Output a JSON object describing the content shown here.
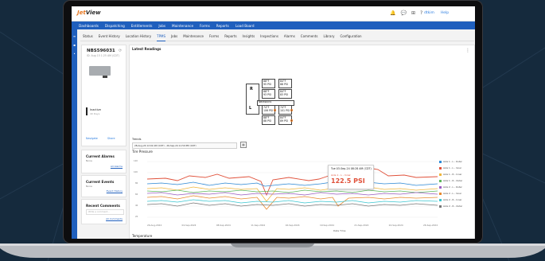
{
  "brand": {
    "logo_prefix": "Jet",
    "logo_suffix": "View"
  },
  "header": {
    "icons": [
      "bell-icon",
      "chat-icon",
      "grid-icon",
      "help-icon"
    ],
    "user": "dtkim",
    "help": "Help"
  },
  "nav": {
    "items": [
      "Dashboards",
      "Dispatching",
      "Entitlements",
      "Jobs",
      "Maintenance",
      "Forms",
      "Reports",
      "Load Board"
    ]
  },
  "tabs": {
    "items": [
      "Status",
      "Event History",
      "Location History",
      "TPMS",
      "Jobs",
      "Maintenance",
      "Forms",
      "Reports",
      "Insights",
      "Inspections",
      "Alarms",
      "Comments",
      "Library",
      "Configuration"
    ],
    "active": "TPMS"
  },
  "asset": {
    "name": "NBS596031",
    "subtitle": "ID: Aug 15 1:25 AM (CDT)",
    "status": "Inactive",
    "status_sub": "40 Days",
    "navigate": "Navigate",
    "share": "Share"
  },
  "alarms": {
    "title": "Current Alarms",
    "value": "None",
    "link": "All Alarms"
  },
  "events": {
    "title": "Current Events",
    "value": "None",
    "link": "Event History"
  },
  "comments": {
    "title": "Recent Comments",
    "placeholder": "Write a comment...",
    "link": "All Comments"
  },
  "readings": {
    "title": "Latest Readings",
    "right_label": "R",
    "left_label": "L",
    "axle_label": "NBS596031",
    "boxes": [
      {
        "t": "88°F",
        "p": "95 PSI"
      },
      {
        "t": "84°F",
        "p": "88 PSI"
      },
      {
        "t": "88°F",
        "p": "93 PSI"
      },
      {
        "t": "84°F",
        "p": "83 PSI"
      },
      {
        "t": "74°F",
        "p": "106 PSI"
      },
      {
        "t": "74°F",
        "p": "101 PSI"
      },
      {
        "t": "88°F",
        "p": "88 PSI"
      },
      {
        "t": "84°F",
        "p": "89 PSI"
      }
    ]
  },
  "trends": {
    "label": "Trends",
    "date_range": "28-Aug-24 12:02 AM (CDT) - 26-Sep-24 11:59 PM (CDT)",
    "chart_title": "Tire Pressure",
    "temp_title": "Temperature",
    "x_title": "Date Time",
    "y_title": "Pressure (psi) / Temp (°F)"
  },
  "chart_data": {
    "type": "line",
    "x": [
      "29-Aug-2024",
      "04-Sep-2024",
      "08-Sep-2024",
      "11-Sep-2024",
      "16-Sep-2024",
      "19-Sep-2024",
      "21-Sep-2024",
      "24-Sep-2024",
      "26-Sep-2024",
      "27-Sep-2024"
    ],
    "y_ticks": [
      "120",
      "100",
      "80",
      "60",
      "40",
      "20"
    ],
    "series": [
      {
        "name": "Axle 1 - L - Outer",
        "color": "#2f8bd8"
      },
      {
        "name": "Axle 1 - L - Inner",
        "color": "#e0513a"
      },
      {
        "name": "Axle 1 - R - Inner",
        "color": "#f0b63c"
      },
      {
        "name": "Axle 1 - R - Outer",
        "color": "#5db85c"
      },
      {
        "name": "Axle 2 - L - Outer",
        "color": "#9c5fc2"
      },
      {
        "name": "Axle 2 - L - Inner",
        "color": "#e88a2f"
      },
      {
        "name": "Axle 2 - R - Inner",
        "color": "#3cc6d0"
      },
      {
        "name": "Axle 2 - R - Outer",
        "color": "#777777"
      }
    ],
    "tooltip": {
      "time": "Tue 03-Sep-24 08:28 AM (CDT)",
      "series": "Axle 1 - L - Inner",
      "value": "122.5 PSI"
    }
  }
}
